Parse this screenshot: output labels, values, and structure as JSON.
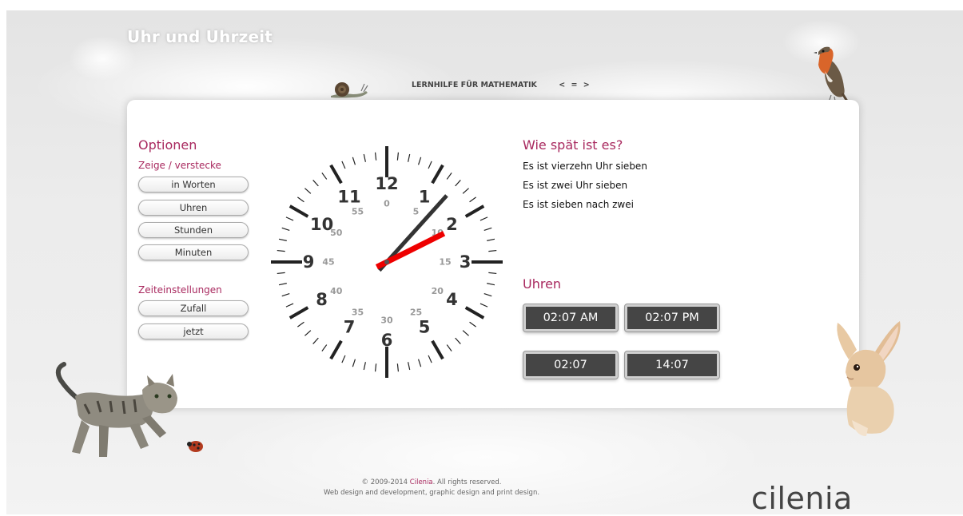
{
  "header": {
    "site_title": "Uhr und Uhrzeit",
    "nav_label": "LERNHILFE FÜR MATHEMATIK",
    "nav_arrows": "< = >"
  },
  "options": {
    "title": "Optionen",
    "show_hide_label": "Zeige / verstecke",
    "toggle_buttons": [
      "in Worten",
      "Uhren",
      "Stunden",
      "Minuten"
    ],
    "time_settings_label": "Zeiteinstellungen",
    "time_buttons": [
      "Zufall",
      "jetzt"
    ]
  },
  "clock": {
    "hour_numbers": [
      "12",
      "1",
      "2",
      "3",
      "4",
      "5",
      "6",
      "7",
      "8",
      "9",
      "10",
      "11"
    ],
    "minute_numbers": [
      "0",
      "5",
      "10",
      "15",
      "20",
      "25",
      "30",
      "35",
      "40",
      "45",
      "50",
      "55"
    ],
    "time": {
      "hour": 2,
      "minute": 7
    },
    "hour_hand_color": "#ee0000",
    "minute_hand_color": "#333333"
  },
  "time_words": {
    "title": "Wie spät ist es?",
    "phrases": [
      "Es ist vierzehn Uhr sieben",
      "Es ist zwei Uhr sieben",
      "Es ist sieben nach zwei"
    ]
  },
  "digital_clocks": {
    "title": "Uhren",
    "displays": [
      "02:07 AM",
      "02:07 PM",
      "02:07",
      "14:07"
    ]
  },
  "footer": {
    "copyright_prefix": "© 2009-2014",
    "brand": "Cilenia",
    "copyright_suffix": ". All rights reserved.",
    "line2": "Web design and development, graphic design and print design.",
    "logo_text": "cilenia"
  },
  "colors": {
    "accent": "#a8285e",
    "button_dark": "#454545",
    "hour_hand": "#ee0000"
  }
}
